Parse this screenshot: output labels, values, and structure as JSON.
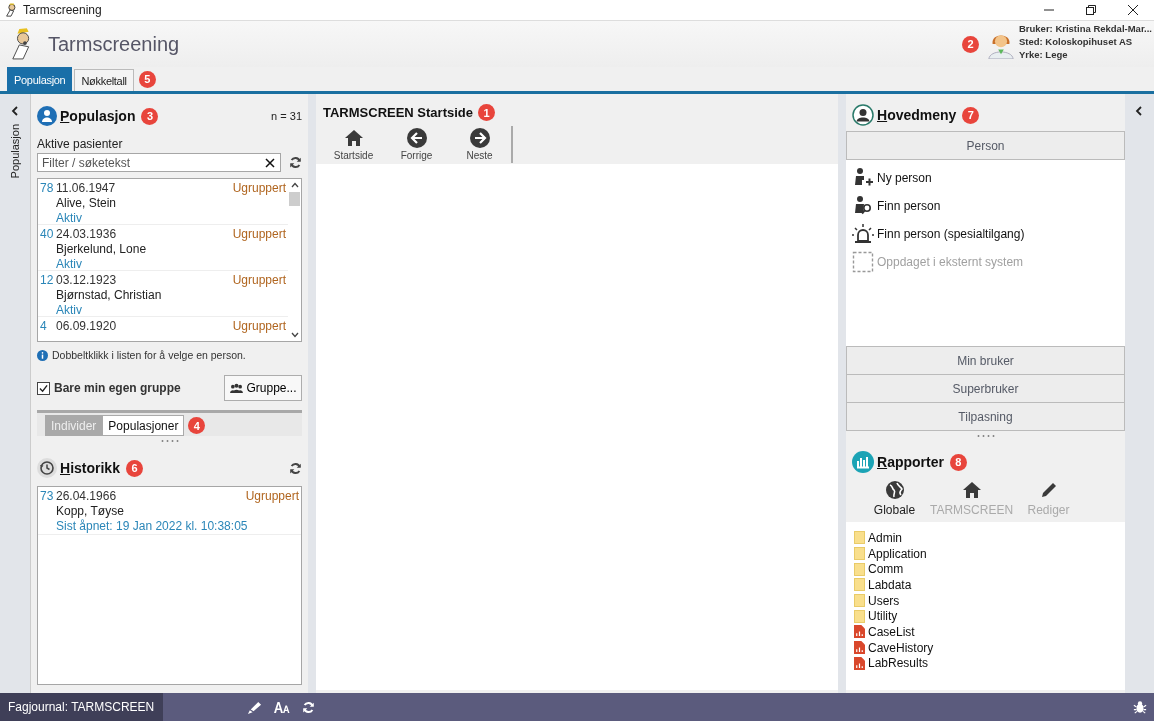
{
  "window": {
    "title": "Tarmscreening"
  },
  "header": {
    "app_name": "Tarmscreening",
    "badge": "2",
    "user_lines": [
      "Bruker: Kristina Rekdal-Mar...",
      "Sted: Koloskopihuset AS",
      "Yrke: Lege"
    ]
  },
  "main_tabs": [
    {
      "label": "Populasjon",
      "selected": true
    },
    {
      "label": "Nøkkeltall",
      "selected": false
    }
  ],
  "main_tabs_badge": "5",
  "left_strip": {
    "label": "Populasjon"
  },
  "population": {
    "title": "Populasjon",
    "badge": "3",
    "count": "n = 31",
    "list_label": "Aktive pasienter",
    "filter": {
      "placeholder": "Filter / søketekst"
    },
    "patients": [
      {
        "number": "78",
        "date": "11.06.1947",
        "group": "Ugruppert",
        "name": "Alive, Stein",
        "status": "Aktiv"
      },
      {
        "number": "40",
        "date": "24.03.1936",
        "group": "Ugruppert",
        "name": "Bjerkelund, Lone",
        "status": "Aktiv"
      },
      {
        "number": "12",
        "date": "03.12.1923",
        "group": "Ugruppert",
        "name": "Bjørnstad, Christian",
        "status": "Aktiv"
      },
      {
        "number": "4",
        "date": "06.09.1920",
        "group": "Ugruppert"
      }
    ],
    "hint": "Dobbeltklikk i listen for å velge en person.",
    "own_group": {
      "label": "Bare min egen gruppe",
      "checked": true
    },
    "group_button": "Gruppe...",
    "view_tabs": [
      {
        "label": "Individer",
        "selected": true
      },
      {
        "label": "Populasjoner",
        "selected": false
      }
    ],
    "view_tabs_badge": "4"
  },
  "history": {
    "title": "Historikk",
    "badge": "6",
    "entries": [
      {
        "number": "73",
        "date": "26.04.1966",
        "group": "Ugruppert",
        "name": "Kopp, Tøyse",
        "status": "Sist åpnet: 19 Jan 2022 kl. 10:38:05"
      }
    ]
  },
  "center": {
    "title": "TARMSCREEN Startside",
    "badge": "1",
    "toolbar": [
      {
        "label": "Startside",
        "kind": "home"
      },
      {
        "label": "Forrige",
        "kind": "back"
      },
      {
        "label": "Neste",
        "kind": "forward"
      }
    ]
  },
  "main_menu": {
    "title": "Hovedmeny",
    "badge": "7",
    "open_section": "Person",
    "items": [
      {
        "label": "Ny person",
        "kind": "add",
        "disabled": false
      },
      {
        "label": "Finn person",
        "kind": "find",
        "disabled": false
      },
      {
        "label": "Finn person (spesialtilgang)",
        "kind": "alarm",
        "disabled": false
      },
      {
        "label": "Oppdaget i eksternt system",
        "kind": "external",
        "disabled": true
      }
    ],
    "sections": [
      "Min bruker",
      "Superbruker",
      "Tilpasning"
    ]
  },
  "reports": {
    "title": "Rapporter",
    "badge": "8",
    "tabs": [
      {
        "label": "Globale",
        "kind": "globe",
        "selected": true
      },
      {
        "label": "TARMSCREEN",
        "kind": "home",
        "selected": false
      },
      {
        "label": "Rediger",
        "kind": "edit",
        "selected": false
      }
    ],
    "tree": [
      {
        "label": "Admin",
        "kind": "folder"
      },
      {
        "label": "Application",
        "kind": "folder"
      },
      {
        "label": "Comm",
        "kind": "folder"
      },
      {
        "label": "Labdata",
        "kind": "folder"
      },
      {
        "label": "Users",
        "kind": "folder"
      },
      {
        "label": "Utility",
        "kind": "folder"
      },
      {
        "label": "CaseList",
        "kind": "report"
      },
      {
        "label": "CaveHistory",
        "kind": "report"
      },
      {
        "label": "LabResults",
        "kind": "report"
      }
    ]
  },
  "status_bar": {
    "journal": "Fagjournal: TARMSCREEN"
  }
}
